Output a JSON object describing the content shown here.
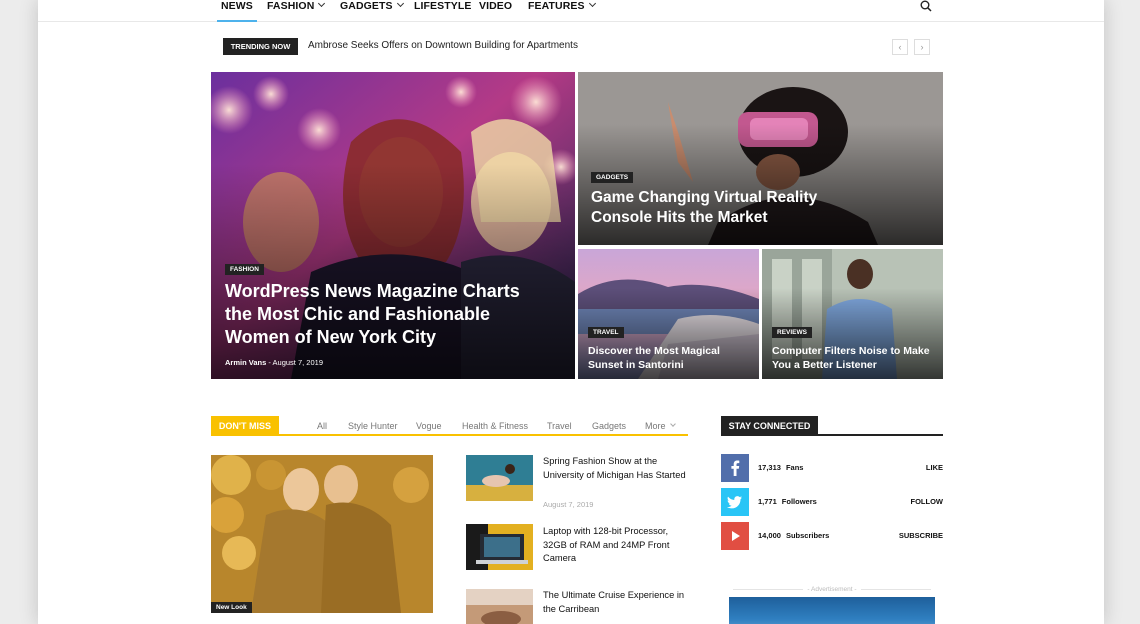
{
  "nav": {
    "items": [
      {
        "label": "NEWS",
        "active": true,
        "dropdown": false
      },
      {
        "label": "FASHION",
        "active": false,
        "dropdown": true
      },
      {
        "label": "GADGETS",
        "active": false,
        "dropdown": true
      },
      {
        "label": "LIFESTYLE",
        "active": false,
        "dropdown": false
      },
      {
        "label": "VIDEO",
        "active": false,
        "dropdown": false
      },
      {
        "label": "FEATURES",
        "active": false,
        "dropdown": true
      }
    ],
    "search_icon": "search-icon",
    "accent_color": "#4db2ec"
  },
  "trending": {
    "label": "TRENDING NOW",
    "headline": "Ambrose Seeks Offers on Downtown Building for Apartments",
    "prev_symbol": "‹",
    "next_symbol": "›"
  },
  "hero": {
    "main": {
      "category": "FASHION",
      "title": "WordPress News Magazine Charts the Most Chic and Fashionable Women of New York City",
      "author": "Armin Vans",
      "separator": " - ",
      "date": "August 7, 2019"
    },
    "top_right": {
      "category": "GADGETS",
      "title": "Game Changing Virtual Reality Console Hits the Market"
    },
    "bottom_left": {
      "category": "TRAVEL",
      "title": "Discover the Most Magical Sunset in Santorini"
    },
    "bottom_right": {
      "category": "REVIEWS",
      "title": "Computer Filters Noise to Make You a Better Listener"
    }
  },
  "dont_miss": {
    "label": "DON'T MISS",
    "accent_color": "#f9c100",
    "filters": [
      "All",
      "Style Hunter",
      "Vogue",
      "Health & Fitness",
      "Travel",
      "Gadgets",
      "More"
    ],
    "featured_category": "New Look",
    "posts": [
      {
        "title": "Spring Fashion Show at the University of Michigan Has Started",
        "date": "August 7, 2019"
      },
      {
        "title": "Laptop with 128-bit Processor, 32GB of RAM and 24MP Front Camera",
        "date": ""
      },
      {
        "title": "The Ultimate Cruise Experience in the Carribean",
        "date": ""
      }
    ]
  },
  "stay_connected": {
    "label": "STAY CONNECTED",
    "rows": [
      {
        "network": "facebook",
        "icon": "facebook-icon",
        "color": "#516eab",
        "count": "17,313",
        "unit": "Fans",
        "action": "LIKE"
      },
      {
        "network": "twitter",
        "icon": "twitter-icon",
        "color": "#29c5f6",
        "count": "1,771",
        "unit": "Followers",
        "action": "FOLLOW"
      },
      {
        "network": "youtube",
        "icon": "youtube-icon",
        "color": "#e14e42",
        "count": "14,000",
        "unit": "Subscribers",
        "action": "SUBSCRIBE"
      }
    ]
  },
  "advertisement": {
    "label": "- Advertisement -"
  }
}
